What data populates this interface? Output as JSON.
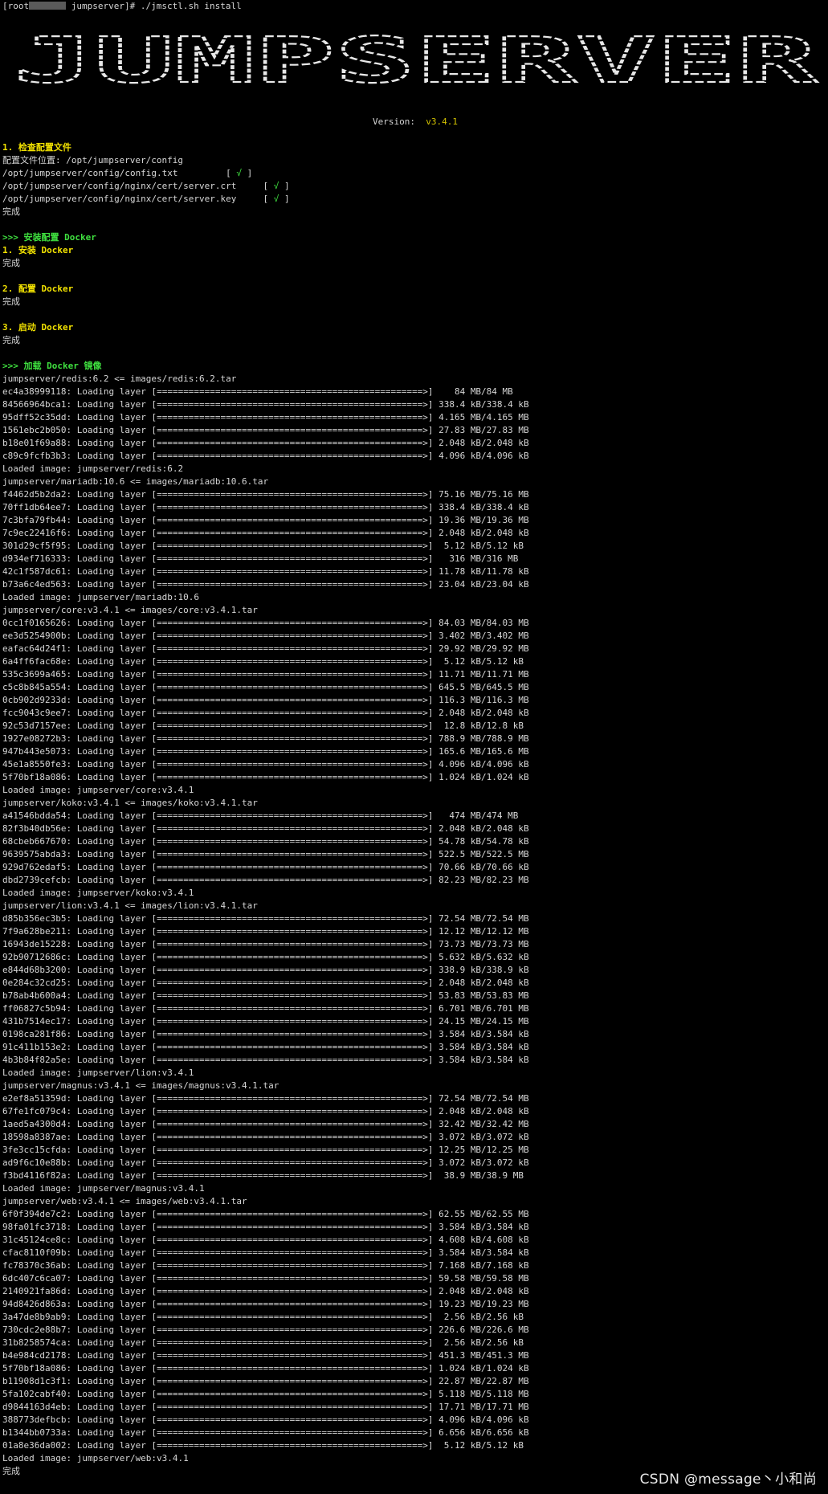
{
  "prompt": {
    "user": "[root",
    "host": "jumpserver]",
    "symbol": "#",
    "command": " ./jmsctl.sh install"
  },
  "banner": {
    "text": "JUMPSERVER",
    "color": "#e8e8e8"
  },
  "version": {
    "label": "Version:",
    "value": "v3.4.1"
  },
  "config_check": {
    "heading": "1. 检查配置文件",
    "location_line": "配置文件位置: /opt/jumpserver/config",
    "files": [
      {
        "path": "/opt/jumpserver/config/config.txt",
        "pad": "         ",
        "status": "√"
      },
      {
        "path": "/opt/jumpserver/config/nginx/cert/server.crt",
        "pad": "     ",
        "status": "√"
      },
      {
        "path": "/opt/jumpserver/config/nginx/cert/server.key",
        "pad": "     ",
        "status": "√"
      }
    ],
    "done": "完成"
  },
  "docker_setup": {
    "heading": ">>> 安装配置 Docker",
    "steps": [
      {
        "title": "1. 安装 Docker",
        "done": "完成"
      },
      {
        "title": "2. 配置 Docker",
        "done": "完成"
      },
      {
        "title": "3. 启动 Docker",
        "done": "完成"
      }
    ]
  },
  "image_load": {
    "heading": ">>> 加载 Docker 镜像",
    "progress_bar": "[==================================================>]",
    "groups": [
      {
        "header": "jumpserver/redis:6.2 <= images/redis:6.2.tar",
        "layers": [
          [
            "ec4a38999118",
            "   84 MB/84 MB"
          ],
          [
            "84566964bca1",
            "338.4 kB/338.4 kB"
          ],
          [
            "95dff52c35dd",
            "4.165 MB/4.165 MB"
          ],
          [
            "1561ebc2b050",
            "27.83 MB/27.83 MB"
          ],
          [
            "b18e01f69a88",
            "2.048 kB/2.048 kB"
          ],
          [
            "c89c9fcfb3b3",
            "4.096 kB/4.096 kB"
          ]
        ],
        "loaded": "Loaded image: jumpserver/redis:6.2"
      },
      {
        "header": "jumpserver/mariadb:10.6 <= images/mariadb:10.6.tar",
        "layers": [
          [
            "f4462d5b2da2",
            "75.16 MB/75.16 MB"
          ],
          [
            "70ff1db64ee7",
            "338.4 kB/338.4 kB"
          ],
          [
            "7c3bfa79fb44",
            "19.36 MB/19.36 MB"
          ],
          [
            "7c9ec22416f6",
            "2.048 kB/2.048 kB"
          ],
          [
            "301d29cf5f95",
            " 5.12 kB/5.12 kB"
          ],
          [
            "d934ef716333",
            "  316 MB/316 MB"
          ],
          [
            "42c1f587dc61",
            "11.78 kB/11.78 kB"
          ],
          [
            "b73a6c4ed563",
            "23.04 kB/23.04 kB"
          ]
        ],
        "loaded": "Loaded image: jumpserver/mariadb:10.6"
      },
      {
        "header": "jumpserver/core:v3.4.1 <= images/core:v3.4.1.tar",
        "layers": [
          [
            "0cc1f0165626",
            "84.03 MB/84.03 MB"
          ],
          [
            "ee3d5254900b",
            "3.402 MB/3.402 MB"
          ],
          [
            "eafac64d24f1",
            "29.92 MB/29.92 MB"
          ],
          [
            "6a4ff6fac68e",
            " 5.12 kB/5.12 kB"
          ],
          [
            "535c3699a465",
            "11.71 MB/11.71 MB"
          ],
          [
            "c5c8b845a554",
            "645.5 MB/645.5 MB"
          ],
          [
            "0cb902d9233d",
            "116.3 MB/116.3 MB"
          ],
          [
            "fcc9043c9ee7",
            "2.048 kB/2.048 kB"
          ],
          [
            "92c53d7157ee",
            " 12.8 kB/12.8 kB"
          ],
          [
            "1927e08272b3",
            "788.9 MB/788.9 MB"
          ],
          [
            "947b443e5073",
            "165.6 MB/165.6 MB"
          ],
          [
            "45e1a8550fe3",
            "4.096 kB/4.096 kB"
          ],
          [
            "5f70bf18a086",
            "1.024 kB/1.024 kB"
          ]
        ],
        "loaded": "Loaded image: jumpserver/core:v3.4.1"
      },
      {
        "header": "jumpserver/koko:v3.4.1 <= images/koko:v3.4.1.tar",
        "layers": [
          [
            "a41546bdda54",
            "  474 MB/474 MB"
          ],
          [
            "82f3b40db56e",
            "2.048 kB/2.048 kB"
          ],
          [
            "68cbeb667670",
            "54.78 kB/54.78 kB"
          ],
          [
            "9639575abda3",
            "522.5 MB/522.5 MB"
          ],
          [
            "929d762edaf5",
            "70.66 kB/70.66 kB"
          ],
          [
            "dbd2739cefcb",
            "82.23 MB/82.23 MB"
          ]
        ],
        "loaded": "Loaded image: jumpserver/koko:v3.4.1"
      },
      {
        "header": "jumpserver/lion:v3.4.1 <= images/lion:v3.4.1.tar",
        "layers": [
          [
            "d85b356ec3b5",
            "72.54 MB/72.54 MB"
          ],
          [
            "7f9a628be211",
            "12.12 MB/12.12 MB"
          ],
          [
            "16943de15228",
            "73.73 MB/73.73 MB"
          ],
          [
            "92b90712686c",
            "5.632 kB/5.632 kB"
          ],
          [
            "e844d68b3200",
            "338.9 kB/338.9 kB"
          ],
          [
            "0e284c32cd25",
            "2.048 kB/2.048 kB"
          ],
          [
            "b78ab4b600a4",
            "53.83 MB/53.83 MB"
          ],
          [
            "ff06827c5b94",
            "6.701 MB/6.701 MB"
          ],
          [
            "431b7514ec17",
            "24.15 MB/24.15 MB"
          ],
          [
            "0198ca281f86",
            "3.584 kB/3.584 kB"
          ],
          [
            "91c411b153e2",
            "3.584 kB/3.584 kB"
          ],
          [
            "4b3b84f82a5e",
            "3.584 kB/3.584 kB"
          ]
        ],
        "loaded": "Loaded image: jumpserver/lion:v3.4.1"
      },
      {
        "header": "jumpserver/magnus:v3.4.1 <= images/magnus:v3.4.1.tar",
        "layers": [
          [
            "e2ef8a51359d",
            "72.54 MB/72.54 MB"
          ],
          [
            "67fe1fc079c4",
            "2.048 kB/2.048 kB"
          ],
          [
            "1aed5a4300d4",
            "32.42 MB/32.42 MB"
          ],
          [
            "18598a8387ae",
            "3.072 kB/3.072 kB"
          ],
          [
            "3fe3cc15cfda",
            "12.25 MB/12.25 MB"
          ],
          [
            "ad9f6c10e88b",
            "3.072 kB/3.072 kB"
          ],
          [
            "f3bd4116f82a",
            " 38.9 MB/38.9 MB"
          ]
        ],
        "loaded": "Loaded image: jumpserver/magnus:v3.4.1"
      },
      {
        "header": "jumpserver/web:v3.4.1 <= images/web:v3.4.1.tar",
        "layers": [
          [
            "6f0f394de7c2",
            "62.55 MB/62.55 MB"
          ],
          [
            "98fa01fc3718",
            "3.584 kB/3.584 kB"
          ],
          [
            "31c45124ce8c",
            "4.608 kB/4.608 kB"
          ],
          [
            "cfac8110f09b",
            "3.584 kB/3.584 kB"
          ],
          [
            "fc78370c36ab",
            "7.168 kB/7.168 kB"
          ],
          [
            "6dc407c6ca07",
            "59.58 MB/59.58 MB"
          ],
          [
            "2140921fa86d",
            "2.048 kB/2.048 kB"
          ],
          [
            "94d8426d863a",
            "19.23 MB/19.23 MB"
          ],
          [
            "3a47de8b9ab9",
            " 2.56 kB/2.56 kB"
          ],
          [
            "730cdc2e88b7",
            "226.6 MB/226.6 MB"
          ],
          [
            "31b8258574ca",
            " 2.56 kB/2.56 kB"
          ],
          [
            "b4e984cd2178",
            "451.3 MB/451.3 MB"
          ],
          [
            "5f70bf18a086",
            "1.024 kB/1.024 kB"
          ],
          [
            "b11908d1c3f1",
            "22.87 MB/22.87 MB"
          ],
          [
            "5fa102cabf40",
            "5.118 MB/5.118 MB"
          ],
          [
            "d9844163d4eb",
            "17.71 MB/17.71 MB"
          ],
          [
            "388773defbcb",
            "4.096 kB/4.096 kB"
          ],
          [
            "b1344bb0733a",
            "6.656 kB/6.656 kB"
          ],
          [
            "01a8e36da002",
            " 5.12 kB/5.12 kB"
          ]
        ],
        "loaded": "Loaded image: jumpserver/web:v3.4.1"
      }
    ],
    "done": "完成"
  },
  "watermark": "CSDN @message丶小和尚"
}
